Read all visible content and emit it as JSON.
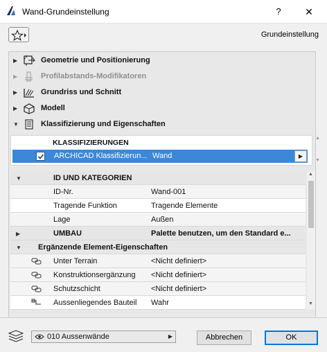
{
  "window": {
    "title": "Wand-Grundeinstellung",
    "help_label": "?",
    "close_label": "✕"
  },
  "toolbar": {
    "preset_label": "Grundeinstellung"
  },
  "sections": [
    {
      "label": "Geometrie und Positionierung",
      "icon": "geometry-icon",
      "expanded": false,
      "enabled": true
    },
    {
      "label": "Profilabstands-Modifikatoren",
      "icon": "profile-offset-icon",
      "expanded": false,
      "enabled": false
    },
    {
      "label": "Grundriss und Schnitt",
      "icon": "floorplan-section-icon",
      "expanded": false,
      "enabled": true
    },
    {
      "label": "Modell",
      "icon": "model-icon",
      "expanded": false,
      "enabled": true
    },
    {
      "label": "Klassifizierung und Eigenschaften",
      "icon": "classification-icon",
      "expanded": true,
      "enabled": true
    }
  ],
  "classification": {
    "header": "KLASSIFIZIERUNGEN",
    "row": {
      "checked": true,
      "name": "ARCHICAD Klassifizierun...",
      "value": "Wand"
    }
  },
  "properties": {
    "groups": [
      {
        "label": "ID UND KATEGORIEN",
        "expanded": true,
        "value": ""
      },
      {
        "label": "UMBAU",
        "expanded": false,
        "value": "Palette benutzen, um den Standard e..."
      },
      {
        "label": "Ergänzende Element-Eigenschaften",
        "expanded": true,
        "value": ""
      }
    ],
    "id_rows": [
      {
        "name": "ID-Nr.",
        "value": "Wand-001"
      },
      {
        "name": "Tragende Funktion",
        "value": "Tragende Elemente"
      },
      {
        "name": "Lage",
        "value": "Außen"
      }
    ],
    "ext_rows": [
      {
        "name": "Unter Terrain",
        "value": "<Nicht definiert>",
        "icon": "link-icon"
      },
      {
        "name": "Konstruktionsergänzung",
        "value": "<Nicht definiert>",
        "icon": "link-icon"
      },
      {
        "name": "Schutzschicht",
        "value": "<Nicht definiert>",
        "icon": "link-icon"
      },
      {
        "name": "Aussenliegendes Bauteil",
        "value": "Wahr",
        "icon": "boolean-icon"
      }
    ]
  },
  "footer": {
    "layer": "010 Aussenwände",
    "cancel_label": "Abbrechen",
    "ok_label": "OK"
  },
  "colors": {
    "selection": "#3b88d9",
    "panel_bg": "#e8e8e8",
    "ok_border": "#0078d7"
  }
}
